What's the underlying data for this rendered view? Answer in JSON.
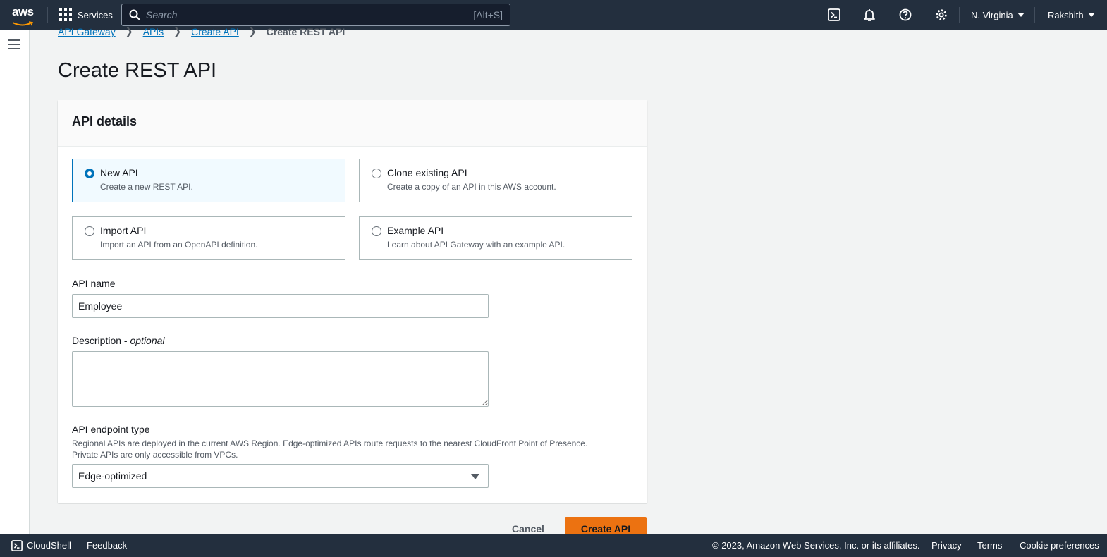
{
  "topnav": {
    "logo": "aws",
    "services_label": "Services",
    "search_placeholder": "Search",
    "search_shortcut": "[Alt+S]",
    "region": "N. Virginia",
    "user": "Rakshith"
  },
  "breadcrumb": {
    "items": [
      "API Gateway",
      "APIs",
      "Create API"
    ],
    "current": "Create REST API"
  },
  "page": {
    "title": "Create REST API"
  },
  "panel": {
    "header": "API details",
    "options": [
      {
        "label": "New API",
        "description": "Create a new REST API.",
        "selected": true
      },
      {
        "label": "Clone existing API",
        "description": "Create a copy of an API in this AWS account.",
        "selected": false
      },
      {
        "label": "Import API",
        "description": "Import an API from an OpenAPI definition.",
        "selected": false
      },
      {
        "label": "Example API",
        "description": "Learn about API Gateway with an example API.",
        "selected": false
      }
    ],
    "api_name_label": "API name",
    "api_name_value": "Employee",
    "description_label": "Description",
    "description_optional": "optional",
    "description_sep": " - ",
    "endpoint_label": "API endpoint type",
    "endpoint_hint_1": "Regional APIs are deployed in the current AWS Region. Edge-optimized APIs route requests to the nearest CloudFront Point of Presence.",
    "endpoint_hint_2": "Private APIs are only accessible from VPCs.",
    "endpoint_value": "Edge-optimized"
  },
  "actions": {
    "cancel": "Cancel",
    "create": "Create API"
  },
  "footer": {
    "cloudshell": "CloudShell",
    "feedback": "Feedback",
    "copyright": "© 2023, Amazon Web Services, Inc. or its affiliates.",
    "privacy": "Privacy",
    "terms": "Terms",
    "cookies": "Cookie preferences"
  },
  "colors": {
    "nav_bg": "#232f3e",
    "accent": "#0073bb",
    "primary_button": "#ec7211",
    "page_bg": "#f2f3f3"
  }
}
